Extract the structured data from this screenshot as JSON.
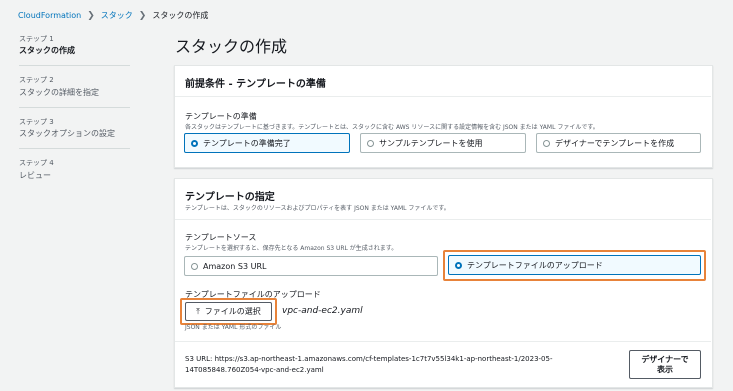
{
  "breadcrumb": {
    "root": "CloudFormation",
    "middle": "スタック",
    "current": "スタックの作成"
  },
  "sidebar": {
    "steps": [
      {
        "step": "ステップ 1",
        "title": "スタックの作成"
      },
      {
        "step": "ステップ 2",
        "title": "スタックの詳細を指定"
      },
      {
        "step": "ステップ 3",
        "title": "スタックオプションの設定"
      },
      {
        "step": "ステップ 4",
        "title": "レビュー"
      }
    ]
  },
  "page": {
    "title": "スタックの作成"
  },
  "prereq": {
    "heading": "前提条件 - テンプレートの準備",
    "label": "テンプレートの準備",
    "description": "各スタックはテンプレートに基づきます。テンプレートとは、スタックに含む AWS リソースに関する設定情報を含む JSON または YAML ファイルです。",
    "options": [
      "テンプレートの準備完了",
      "サンプルテンプレートを使用",
      "デザイナーでテンプレートを作成"
    ],
    "selected_index": 0
  },
  "spec": {
    "heading": "テンプレートの指定",
    "description": "テンプレートは、スタックのリソースおよびプロパティを表す JSON または YAML ファイルです。",
    "source_label": "テンプレートソース",
    "source_description": "テンプレートを選択すると、保存先となる Amazon S3 URL が生成されます。",
    "source_options": [
      "Amazon S3 URL",
      "テンプレートファイルのアップロード"
    ],
    "source_selected_index": 1,
    "upload_label": "テンプレートファイルのアップロード",
    "choose_file_button": "ファイルの選択",
    "file_name": "vpc-and-ec2.yaml",
    "file_hint": "JSON または YAML 形式のファイル",
    "s3_url_line1": "S3 URL:   https://s3.ap-northeast-1.amazonaws.com/cf-templates-1c7t7v55l34k1-ap-northeast-1/2023-05-",
    "s3_url_line2": "14T085848.760Z054-vpc-and-ec2.yaml",
    "designer_button_line1": "デザイナーで",
    "designer_button_line2": "表示"
  },
  "colors": {
    "accent": "#0073bb",
    "highlight": "#e8833a",
    "background": "#f2f3f3"
  }
}
